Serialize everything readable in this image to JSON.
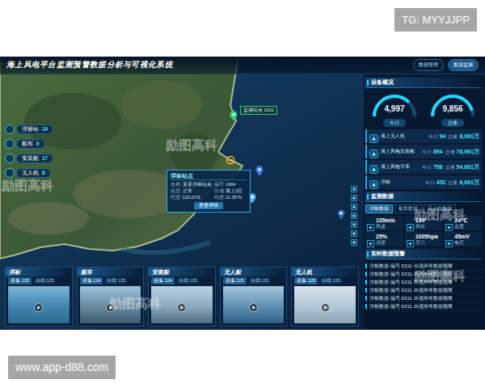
{
  "top_badge": "TG: MYYJJPP",
  "bottom_badge": "www.app-d88.com",
  "title": "海上风电平台监测预警数据分析与可视化系统",
  "header_buttons": [
    {
      "label": "数据管理",
      "selected": false
    },
    {
      "label": "数据监测",
      "selected": true
    }
  ],
  "layers": [
    {
      "label": "浮标站",
      "count": "24"
    },
    {
      "label": "船车",
      "count": "6"
    },
    {
      "label": "安装船",
      "count": "17"
    },
    {
      "label": "无人机",
      "count": "8"
    }
  ],
  "map_pins": [
    {
      "kind": "station",
      "color": "#35d07f",
      "label": "监测站点 S311"
    },
    {
      "kind": "target",
      "color": "#f2c230"
    },
    {
      "kind": "station",
      "color": "#3d7bff"
    },
    {
      "kind": "station",
      "color": "#4fb6e8"
    },
    {
      "kind": "station",
      "color": "#2f6fa8"
    }
  ],
  "popup": {
    "title": "浮标站点",
    "fields": [
      {
        "label": "名称:",
        "value": "某某浮标站点"
      },
      {
        "label": "编号:",
        "value": "1964"
      },
      {
        "label": "状态:",
        "value": "正常"
      },
      {
        "label": "区域:",
        "value": "海上1区"
      },
      {
        "label": "经度:",
        "value": "118.32°E"
      },
      {
        "label": "纬度:",
        "value": "21.35°N"
      }
    ],
    "button": "查看详情"
  },
  "cards": [
    {
      "title": "浮标",
      "tabs": [
        {
          "label": "设备 125",
          "selected": true
        },
        {
          "label": "在线 125",
          "selected": false
        }
      ]
    },
    {
      "title": "船车",
      "tabs": [
        {
          "label": "设备 124",
          "selected": true
        },
        {
          "label": "在线 125",
          "selected": false
        }
      ]
    },
    {
      "title": "安装船",
      "tabs": [
        {
          "label": "设备 124",
          "selected": true
        },
        {
          "label": "在线 125",
          "selected": false
        }
      ]
    },
    {
      "title": "无人船",
      "tabs": [
        {
          "label": "设备 125",
          "selected": true
        },
        {
          "label": "在线 125",
          "selected": false
        }
      ]
    },
    {
      "title": "无人机",
      "tabs": [
        {
          "label": "设备 125",
          "selected": true
        },
        {
          "label": "在线 125",
          "selected": false
        }
      ]
    }
  ],
  "stats": {
    "title": "设备概况",
    "gauges": [
      {
        "value": "4,997",
        "label": "今日",
        "level": 0.75
      },
      {
        "value": "9,856",
        "label": "总量",
        "level": 0.9
      }
    ],
    "rows": [
      {
        "name": "海上无人机",
        "today_label": "今日",
        "today": "94",
        "total_label": "总量",
        "total": "8,961万"
      },
      {
        "name": "海上风电安装船",
        "today_label": "今日",
        "today": "894",
        "total_label": "总量",
        "total": "78,961万"
      },
      {
        "name": "海上风电平车",
        "today_label": "今日",
        "today": "758",
        "total_label": "总量",
        "total": "54,661万"
      },
      {
        "name": "浮标",
        "today_label": "今日",
        "today": "452",
        "total_label": "总量",
        "total": "6,661万"
      }
    ]
  },
  "monitor": {
    "title": "监测数据",
    "tabs": [
      {
        "label": "浮标数据",
        "selected": true
      },
      {
        "label": "船车数据",
        "selected": false
      },
      {
        "label": "无人机数据",
        "selected": false
      }
    ],
    "items": [
      {
        "label": "风速",
        "value": "105m/s"
      },
      {
        "label": "风向",
        "value": "134°"
      },
      {
        "label": "温度",
        "value": "24℃"
      },
      {
        "label": "湿度",
        "value": "25%"
      },
      {
        "label": "压力",
        "value": "1005hpa"
      },
      {
        "label": "电压",
        "value": "45mV"
      }
    ]
  },
  "alerts": {
    "title": "实时数据预警",
    "rows": [
      "浮标数据 编号 S311 出现异常数据预警",
      "浮标数据 编号 S311 出现异常数据预警",
      "浮标数据 编号 S311 出现异常数据预警",
      "浮标数据 编号 S311 出现异常数据预警",
      "浮标数据 编号 S311 出现异常数据预警",
      "浮标数据 编号 S311 出现异常数据预警"
    ]
  },
  "watermark": "励图高科"
}
